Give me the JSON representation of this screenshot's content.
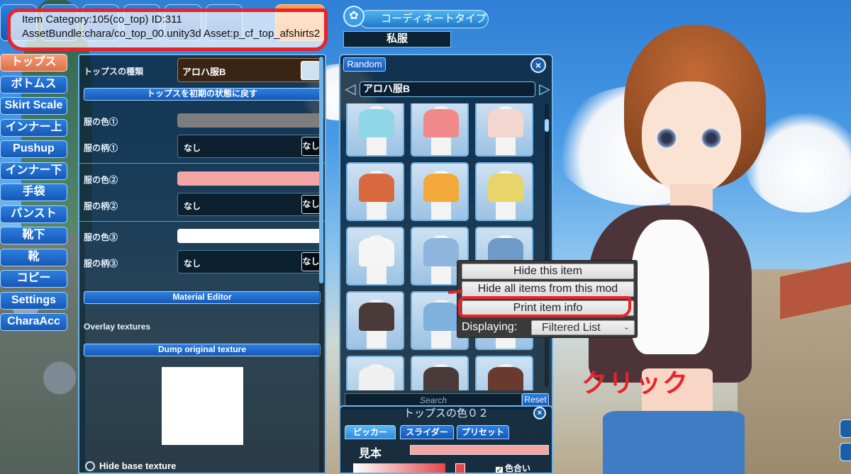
{
  "item_info": {
    "line1": "Item Category:105(co_top) ID:311",
    "line2": "AssetBundle:chara/co_top_00.unity3d Asset:p_cf_top_afshirts2"
  },
  "categories": [
    {
      "label": "トップス",
      "active": true
    },
    {
      "label": "ボトムス",
      "active": false
    },
    {
      "label": "Skirt Scale",
      "active": false
    },
    {
      "label": "インナー上",
      "active": false
    },
    {
      "label": "Pushup",
      "active": false
    },
    {
      "label": "インナー下",
      "active": false
    },
    {
      "label": "手袋",
      "active": false
    },
    {
      "label": "パンスト",
      "active": false
    },
    {
      "label": "靴下",
      "active": false
    },
    {
      "label": "靴",
      "active": false
    },
    {
      "label": "コピー",
      "active": false
    },
    {
      "label": "Settings",
      "active": false
    },
    {
      "label": "CharaAcc",
      "active": false
    }
  ],
  "settings": {
    "type_label": "トップスの種類",
    "type_value": "アロハ服B",
    "reset_button": "トップスを初期の状態に戻す",
    "color1_label": "服の色①",
    "color1": "#7d7d7d",
    "pattern1_label": "服の柄①",
    "pattern1_value": "なし",
    "pattern1_thumb": "なし",
    "color2_label": "服の色②",
    "color2": "#f4a5a5",
    "pattern2_label": "服の柄②",
    "pattern2_value": "なし",
    "pattern2_thumb": "なし",
    "color3_label": "服の色③",
    "color3": "#ffffff",
    "pattern3_label": "服の柄③",
    "pattern3_value": "なし",
    "pattern3_thumb": "なし",
    "material_editor": "Material Editor",
    "overlay_textures": "Overlay textures",
    "dump_texture": "Dump original texture",
    "hide_base_texture": "Hide base texture"
  },
  "coordinate": {
    "title": "コーディネートタイプ",
    "value": "私服"
  },
  "list_panel": {
    "random_button": "Random",
    "close_icon": "×",
    "prev_arrow": "◁",
    "next_arrow": "▷",
    "item_name": "アロハ服B",
    "search_placeholder": "Search",
    "reset_button": "Reset",
    "thumbnails": [
      {
        "color": "#8fd6e6"
      },
      {
        "color": "#f08a8a"
      },
      {
        "color": "#f4d6d0"
      },
      {
        "color": "#d9693f"
      },
      {
        "color": "#f3a93a"
      },
      {
        "color": "#e8d56a"
      },
      {
        "color": "#f5f5f5"
      },
      {
        "color": "#8db5de"
      },
      {
        "color": "#6f9bc8"
      },
      {
        "color": "#4a3a3a"
      },
      {
        "color": "#7fb0de"
      },
      {
        "color": "#f5f5f5"
      },
      {
        "color": "#f0f0f0"
      },
      {
        "color": "#4a3a3a"
      },
      {
        "color": "#6a3a2f"
      }
    ]
  },
  "color_panel": {
    "title": "トップスの色０２",
    "close_icon": "×",
    "tabs": [
      "ピッカー",
      "スライダー",
      "プリセット"
    ],
    "sample_label": "見本",
    "sample_color": "#f4a5a5",
    "alpha_label": "色合い",
    "alpha_checked": true
  },
  "context_menu": {
    "items": [
      "Hide this item",
      "Hide all items from this mod",
      "Print item info"
    ],
    "display_label": "Displaying:",
    "display_value": "Filtered List"
  },
  "annotation": {
    "click_label": "クリック",
    "accent": "#e8242a"
  }
}
